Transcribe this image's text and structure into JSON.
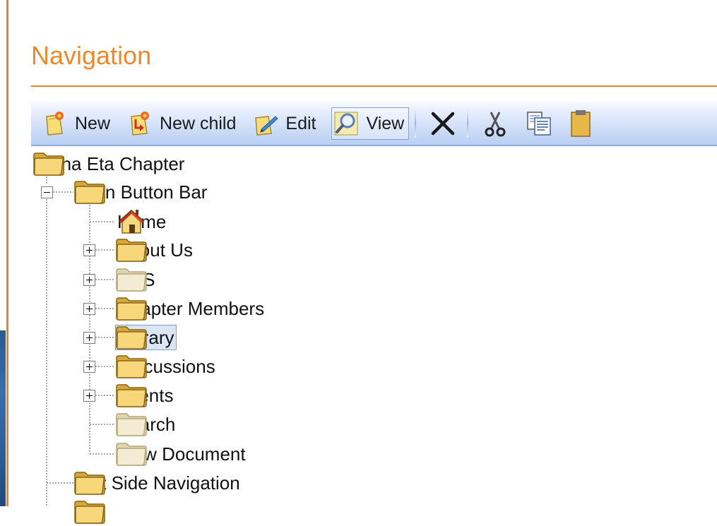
{
  "title": "Navigation",
  "toolbar": {
    "new_label": "New",
    "new_child_label": "New child",
    "edit_label": "Edit",
    "view_label": "View"
  },
  "tree": {
    "root": "Alpha Eta Chapter",
    "main": "Main Button Bar",
    "items": [
      {
        "label": "Home",
        "icon": "home-icon"
      },
      {
        "label": "About Us",
        "icon": "folder-icon"
      },
      {
        "label": "RSS",
        "icon": "folder-faded-icon"
      },
      {
        "label": "Chapter Members",
        "icon": "folder-icon"
      },
      {
        "label": "Library",
        "icon": "folder-icon",
        "selected": true
      },
      {
        "label": "Discussions",
        "icon": "folder-icon"
      },
      {
        "label": "Events",
        "icon": "folder-icon"
      },
      {
        "label": "Search",
        "icon": "folder-faded-icon"
      },
      {
        "label": "View Document",
        "icon": "folder-faded-icon"
      }
    ],
    "left_side": "Left Side Navigation"
  },
  "colors": {
    "accent": "#ea8a2d",
    "toolbar_top": "#f5f8ff",
    "toolbar_bottom": "#b9cff1",
    "selection": "#dae5f5"
  }
}
